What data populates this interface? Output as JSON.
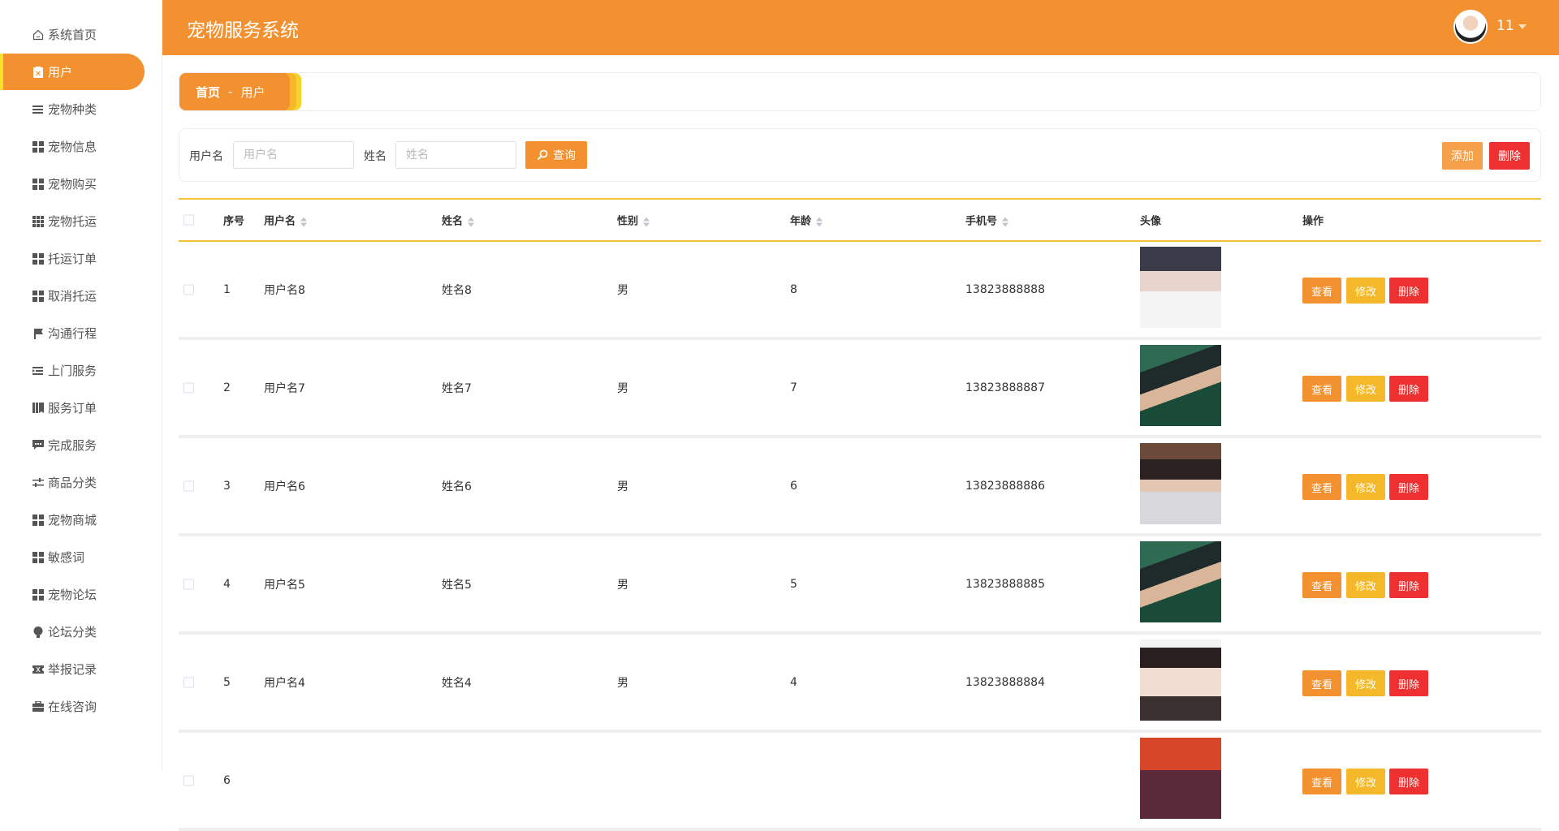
{
  "app": {
    "title": "宠物服务系统",
    "user": "11"
  },
  "colors": {
    "primary": "#f39130",
    "warning": "#f5b82a",
    "danger": "#ee3030",
    "accent": "#f2c23c"
  },
  "sidebar": {
    "items": [
      {
        "label": "系统首页",
        "icon": "home-icon"
      },
      {
        "label": "用户",
        "icon": "clipboard-icon",
        "active": true
      },
      {
        "label": "宠物种类",
        "icon": "list-icon"
      },
      {
        "label": "宠物信息",
        "icon": "grid-icon"
      },
      {
        "label": "宠物购买",
        "icon": "grid-icon"
      },
      {
        "label": "宠物托运",
        "icon": "apps-icon"
      },
      {
        "label": "托运订单",
        "icon": "grid-icon"
      },
      {
        "label": "取消托运",
        "icon": "grid-icon"
      },
      {
        "label": "沟通行程",
        "icon": "flag-icon"
      },
      {
        "label": "上门服务",
        "icon": "indent-icon"
      },
      {
        "label": "服务订单",
        "icon": "book-icon"
      },
      {
        "label": "完成服务",
        "icon": "comment-icon"
      },
      {
        "label": "商品分类",
        "icon": "sliders-icon"
      },
      {
        "label": "宠物商城",
        "icon": "grid-icon"
      },
      {
        "label": "敏感词",
        "icon": "grid-icon"
      },
      {
        "label": "宠物论坛",
        "icon": "grid-icon"
      },
      {
        "label": "论坛分类",
        "icon": "bulb-icon"
      },
      {
        "label": "举报记录",
        "icon": "ticket-icon"
      },
      {
        "label": "在线咨询",
        "icon": "briefcase-icon"
      }
    ]
  },
  "breadcrumb": {
    "home": "首页",
    "sep": "-",
    "current": "用户"
  },
  "search": {
    "username_label": "用户名",
    "username_placeholder": "用户名",
    "username_value": "",
    "name_label": "姓名",
    "name_placeholder": "姓名",
    "name_value": "",
    "query_button": "查询",
    "add_button": "添加",
    "delete_button": "删除"
  },
  "table": {
    "headers": {
      "index": "序号",
      "username": "用户名",
      "name": "姓名",
      "gender": "性别",
      "age": "年龄",
      "phone": "手机号",
      "avatar": "头像",
      "actions": "操作"
    },
    "action_labels": {
      "view": "查看",
      "edit": "修改",
      "delete": "删除"
    },
    "rows": [
      {
        "index": "1",
        "username": "用户名8",
        "name": "姓名8",
        "gender": "男",
        "age": "8",
        "phone": "13823888888"
      },
      {
        "index": "2",
        "username": "用户名7",
        "name": "姓名7",
        "gender": "男",
        "age": "7",
        "phone": "13823888887"
      },
      {
        "index": "3",
        "username": "用户名6",
        "name": "姓名6",
        "gender": "男",
        "age": "6",
        "phone": "13823888886"
      },
      {
        "index": "4",
        "username": "用户名5",
        "name": "姓名5",
        "gender": "男",
        "age": "5",
        "phone": "13823888885"
      },
      {
        "index": "5",
        "username": "用户名4",
        "name": "姓名4",
        "gender": "男",
        "age": "4",
        "phone": "13823888884"
      },
      {
        "index": "6",
        "username": "",
        "name": "",
        "gender": "",
        "age": "",
        "phone": ""
      }
    ]
  }
}
